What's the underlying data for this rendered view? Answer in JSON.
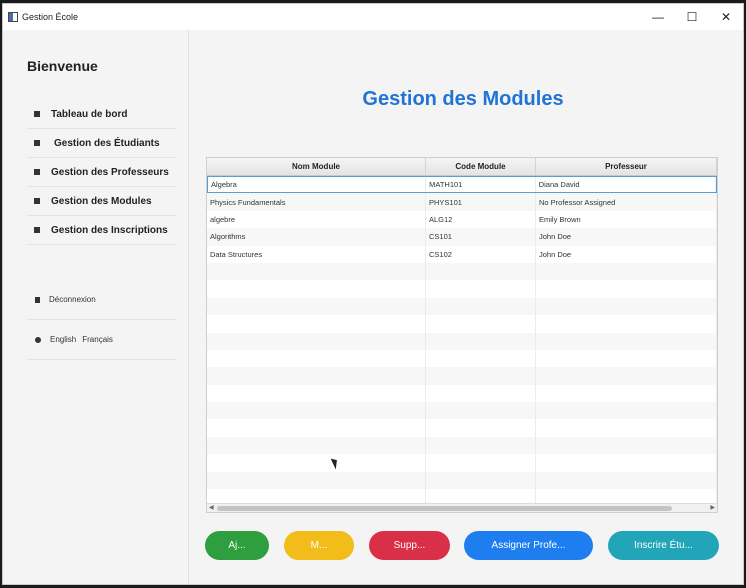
{
  "window": {
    "title": "Gestion École",
    "controls": [
      "—",
      "☐",
      "✕"
    ]
  },
  "sidebar": {
    "welcome": "Bienvenue",
    "items": [
      {
        "label": "Tableau de bord",
        "icon": "home-icon"
      },
      {
        "label": "Gestion des Étudiants",
        "icon": "student-icon"
      },
      {
        "label": "Gestion des Professeurs",
        "icon": "professor-icon"
      },
      {
        "label": "Gestion des Modules",
        "icon": "module-icon"
      },
      {
        "label": "Gestion des Inscriptions",
        "icon": "enrollment-icon"
      }
    ],
    "logout": "Déconnexion",
    "languages": [
      "English",
      "Français"
    ]
  },
  "main": {
    "title": "Gestion des Modules",
    "table": {
      "columns": [
        "Nom Module",
        "Code Module",
        "Professeur"
      ],
      "rows": [
        [
          "Algebra",
          "MATH101",
          "Diana David"
        ],
        [
          "Physics Fundamentals",
          "PHYS101",
          "No Professor Assigned"
        ],
        [
          "algebre",
          "ALG12",
          "Emily Brown"
        ],
        [
          "Algorithms",
          "CS101",
          "John Doe"
        ],
        [
          "Data Structures",
          "CS102",
          "John Doe"
        ]
      ],
      "empty_rows": 14
    },
    "buttons": [
      {
        "label": "Aj...",
        "color": "#2e9e3f"
      },
      {
        "label": "M...",
        "color": "#f2bc1b"
      },
      {
        "label": "Supp...",
        "color": "#d93048"
      },
      {
        "label": "Assigner Profe...",
        "color": "#1e7ef0"
      },
      {
        "label": "Inscrire Étu...",
        "color": "#22a5b8"
      }
    ]
  }
}
